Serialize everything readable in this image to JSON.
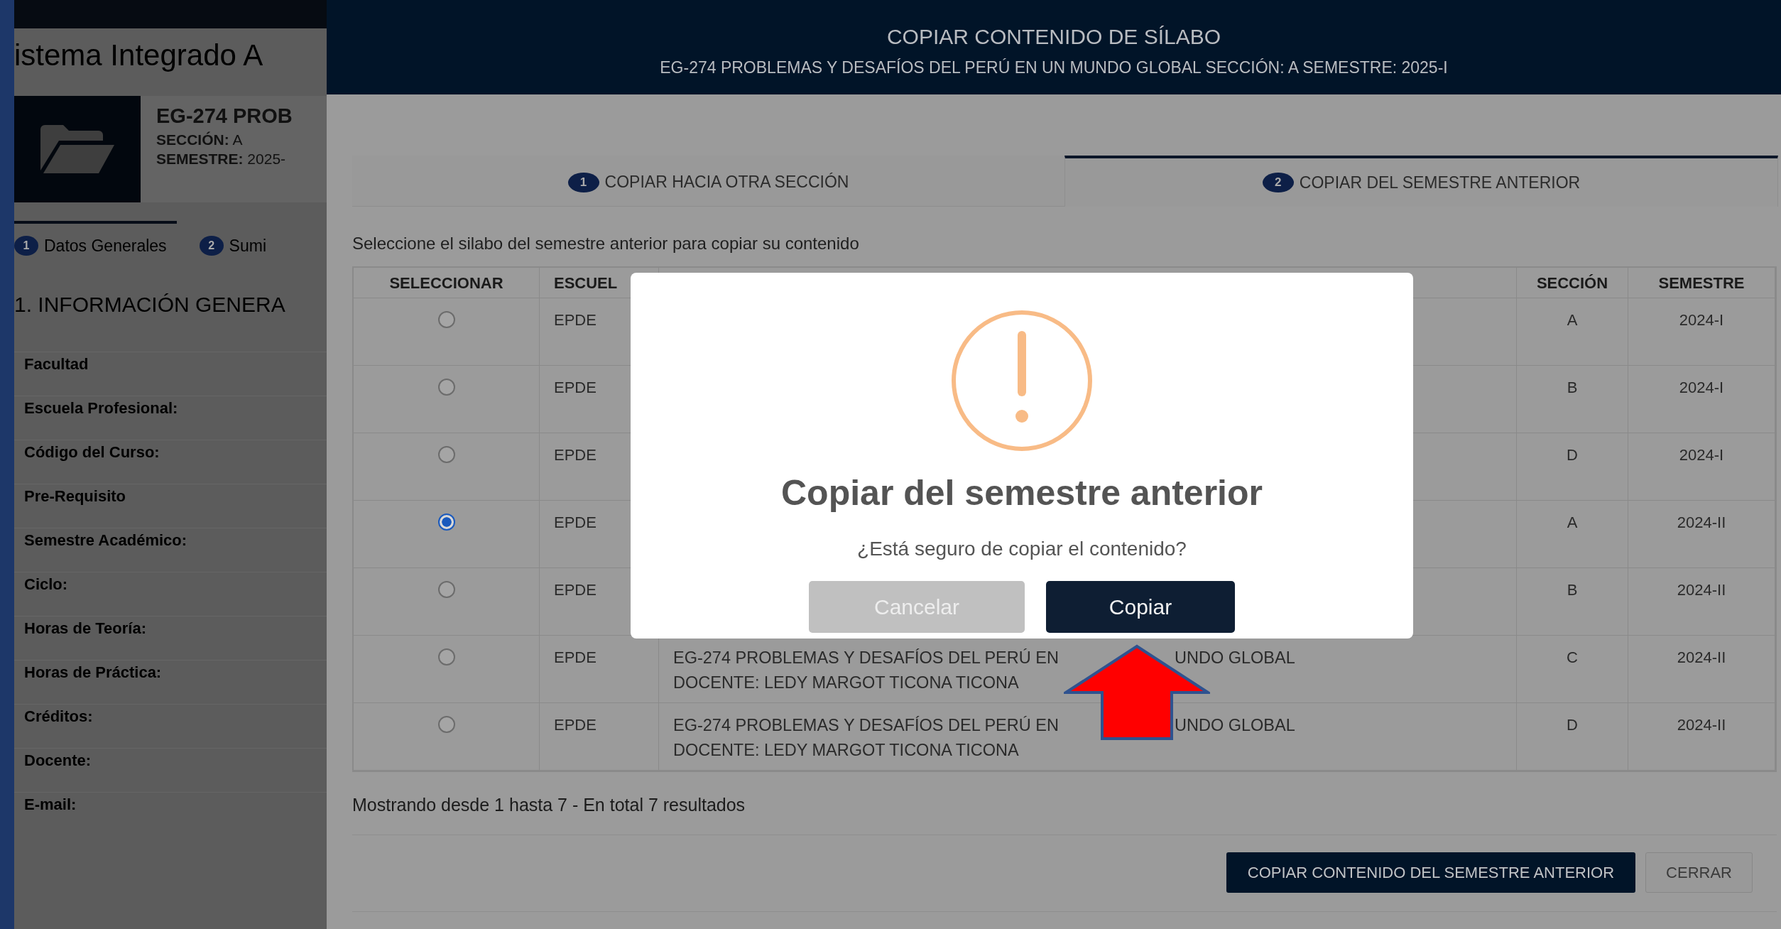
{
  "background_page": {
    "app_title": "istema Integrado A",
    "course_title": "EG-274 PROB",
    "section_label": "SECCIÓN:",
    "section_value": "A",
    "semester_label": "SEMESTRE:",
    "semester_value": "2025-",
    "tabs": [
      {
        "number": "1",
        "label": "Datos Generales",
        "selected": true
      },
      {
        "number": "2",
        "label": "Sumi",
        "selected": false
      }
    ],
    "section_heading": "1. INFORMACIÓN GENERA",
    "fields": [
      "Facultad",
      "Escuela Profesional:",
      "Código del Curso:",
      "Pre-Requisito",
      "Semestre Académico:",
      "Ciclo:",
      "Horas de Teoría:",
      "Horas de Práctica:",
      "Créditos:",
      "Docente:",
      "E-mail:"
    ]
  },
  "modal": {
    "title": "COPIAR CONTENIDO DE SÍLABO",
    "subtitle": "EG-274 PROBLEMAS Y DESAFÍOS DEL PERÚ EN UN MUNDO GLOBAL SECCIÓN: A SEMESTRE: 2025-I",
    "tabs": [
      {
        "number": "1",
        "label": "COPIAR HACIA OTRA SECCIÓN",
        "selected": false
      },
      {
        "number": "2",
        "label": "COPIAR DEL SEMESTRE ANTERIOR",
        "selected": true
      }
    ],
    "instruction": "Seleccione el silabo del semestre anterior para copiar su contenido",
    "table": {
      "columns": [
        "SELECCIONAR",
        "ESCUEL",
        "SECCIÓN",
        "SEMESTRE"
      ],
      "rows": [
        {
          "selected": false,
          "school": "EPDE",
          "section": "A",
          "semester": "2024-I"
        },
        {
          "selected": false,
          "school": "EPDE",
          "section": "B",
          "semester": "2024-I"
        },
        {
          "selected": false,
          "school": "EPDE",
          "section": "D",
          "semester": "2024-I"
        },
        {
          "selected": true,
          "school": "EPDE",
          "section": "A",
          "semester": "2024-II"
        },
        {
          "selected": false,
          "school": "EPDE",
          "section": "B",
          "semester": "2024-II"
        },
        {
          "selected": false,
          "school": "EPDE",
          "course": [
            [
              "EG-274 PROBLEMAS Y DESAFÍOS DEL PERÚ EN",
              "UNDO GLOBAL"
            ],
            [
              "DOCENTE: LEDY MARGOT TICONA TICONA"
            ]
          ],
          "section": "C",
          "semester": "2024-II"
        },
        {
          "selected": false,
          "school": "EPDE",
          "course": [
            [
              "EG-274 PROBLEMAS Y DESAFÍOS DEL PERÚ EN",
              "UNDO GLOBAL"
            ],
            [
              "DOCENTE: LEDY MARGOT TICONA TICONA"
            ]
          ],
          "section": "D",
          "semester": "2024-II"
        }
      ]
    },
    "results_text": "Mostrando desde 1 hasta 7 - En total 7 resultados",
    "buttons": [
      {
        "kind": "primary",
        "label": "COPIAR CONTENIDO DEL SEMESTRE ANTERIOR"
      },
      {
        "kind": "secondary",
        "label": "CERRAR"
      }
    ]
  },
  "dialog": {
    "title": "Copiar del semestre anterior",
    "message": "¿Está seguro de copiar el contenido?",
    "buttons": [
      {
        "kind": "cancel",
        "label": "Cancelar"
      },
      {
        "kind": "confirm",
        "label": "Copiar"
      }
    ]
  }
}
